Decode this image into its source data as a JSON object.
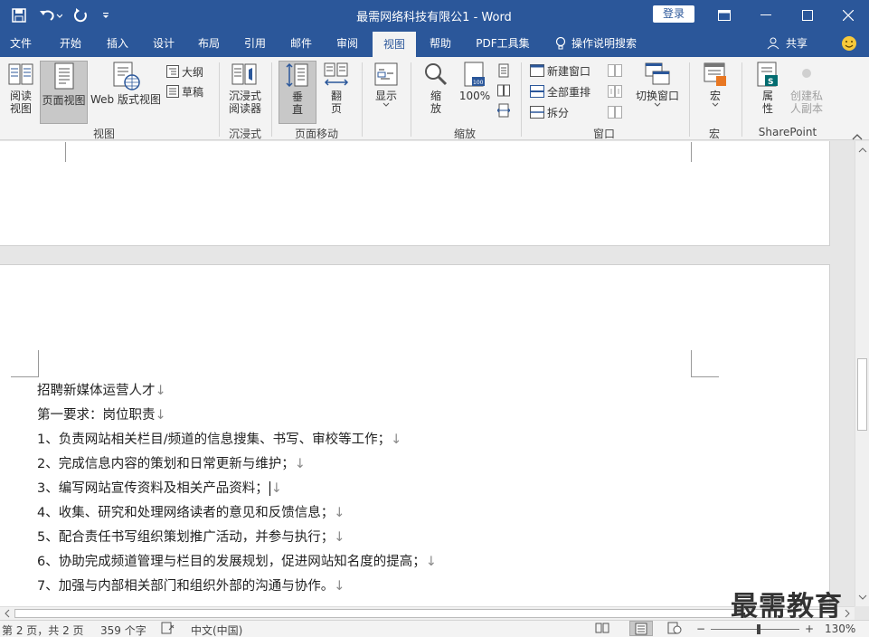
{
  "window": {
    "title": "最需网络科技有限公1  -  Word",
    "login_label": "登录"
  },
  "tabs": [
    {
      "label": "文件"
    },
    {
      "label": "开始"
    },
    {
      "label": "插入"
    },
    {
      "label": "设计"
    },
    {
      "label": "布局"
    },
    {
      "label": "引用"
    },
    {
      "label": "邮件"
    },
    {
      "label": "审阅"
    },
    {
      "label": "视图",
      "active": true
    },
    {
      "label": "帮助"
    },
    {
      "label": "PDF工具集"
    },
    {
      "label": "操作说明搜索"
    }
  ],
  "share_label": "共享",
  "ribbon": {
    "view_group": {
      "read_mode": "阅读\n视图",
      "print_layout": "页面视图",
      "web_layout": "Web 版式视图",
      "outline": "大纲",
      "draft": "草稿",
      "label": "视图"
    },
    "immersive_group": {
      "reader": "沉浸式\n阅读器",
      "label": "沉浸式"
    },
    "page_move_group": {
      "vertical": "垂\n直",
      "side": "翻\n页",
      "label": "页面移动"
    },
    "show_group": {
      "show": "显示"
    },
    "zoom_group": {
      "zoom": "缩\n放",
      "hundred": "100%",
      "label": "缩放"
    },
    "window_group": {
      "new_window": "新建窗口",
      "arrange_all": "全部重排",
      "split": "拆分",
      "switch_windows": "切换窗口",
      "label": "窗口"
    },
    "macro_group": {
      "macros": "宏",
      "label": "宏"
    },
    "sharepoint_group": {
      "properties": "属\n性",
      "private_copy": "创建私\n人副本",
      "label": "SharePoint"
    }
  },
  "document": {
    "lines": [
      "招聘新媒体运营人才",
      "第一要求：岗位职责",
      "1、负责网站相关栏目/频道的信息搜集、书写、审校等工作；",
      "2、完成信息内容的策划和日常更新与维护；",
      "3、编写网站宣传资料及相关产品资料；",
      "4、收集、研究和处理网络读者的意见和反馈信息；",
      "5、配合责任书写组织策划推广活动，并参与执行；",
      "6、协助完成频道管理与栏目的发展规划，促进网站知名度的提高；",
      "7、加强与内部相关部门和组织外部的沟通与协作。"
    ],
    "para_mark": "↓"
  },
  "status": {
    "page": "第 2 页，共 2 页",
    "words": "359 个字",
    "language": "中文(中国)",
    "zoom": "130%"
  },
  "watermark": "最需教育",
  "colors": {
    "accent": "#2b579a",
    "ribbon_bg": "#f3f3f3",
    "selected": "#c8c8c8"
  }
}
